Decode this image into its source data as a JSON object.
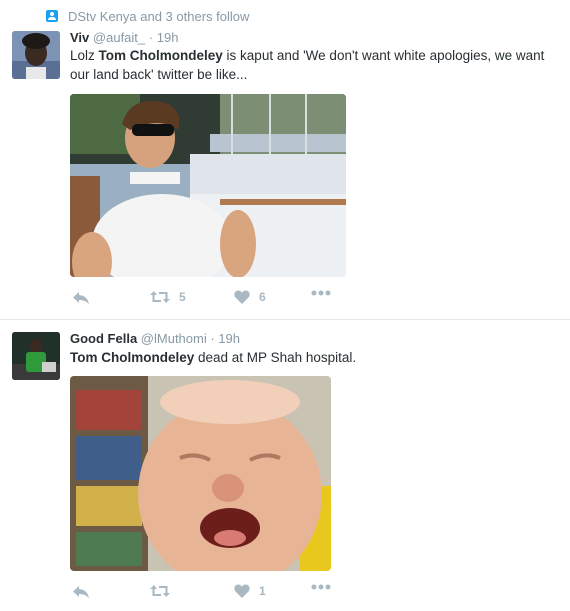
{
  "timeline": {
    "tweets": [
      {
        "context": "DStv Kenya and 3 others follow",
        "name": "Viv",
        "handle": "@aufait_",
        "separator": "·",
        "time": "19h",
        "text_pre": "Lolz ",
        "text_bold": "Tom Cholmondeley",
        "text_post": " is kaput and 'We don't want white apologies, we want our land back' twitter be like...",
        "retweets": "5",
        "likes": "6"
      },
      {
        "name": "Good Fella",
        "handle": "@lMuthomi",
        "separator": "·",
        "time": "19h",
        "text_bold": "Tom Cholmondeley",
        "text_post": " dead at MP Shah hospital.",
        "retweets": "",
        "likes": "1"
      }
    ]
  },
  "icons": {
    "context": "user-follow-icon",
    "reply": "reply-icon",
    "retweet": "retweet-icon",
    "like": "heart-icon",
    "more": "more-dots-icon"
  },
  "colors": {
    "accent": "#1da1f2",
    "icon_gray": "#aab8c2",
    "meta_gray": "#8899a6",
    "text": "#292f33"
  }
}
